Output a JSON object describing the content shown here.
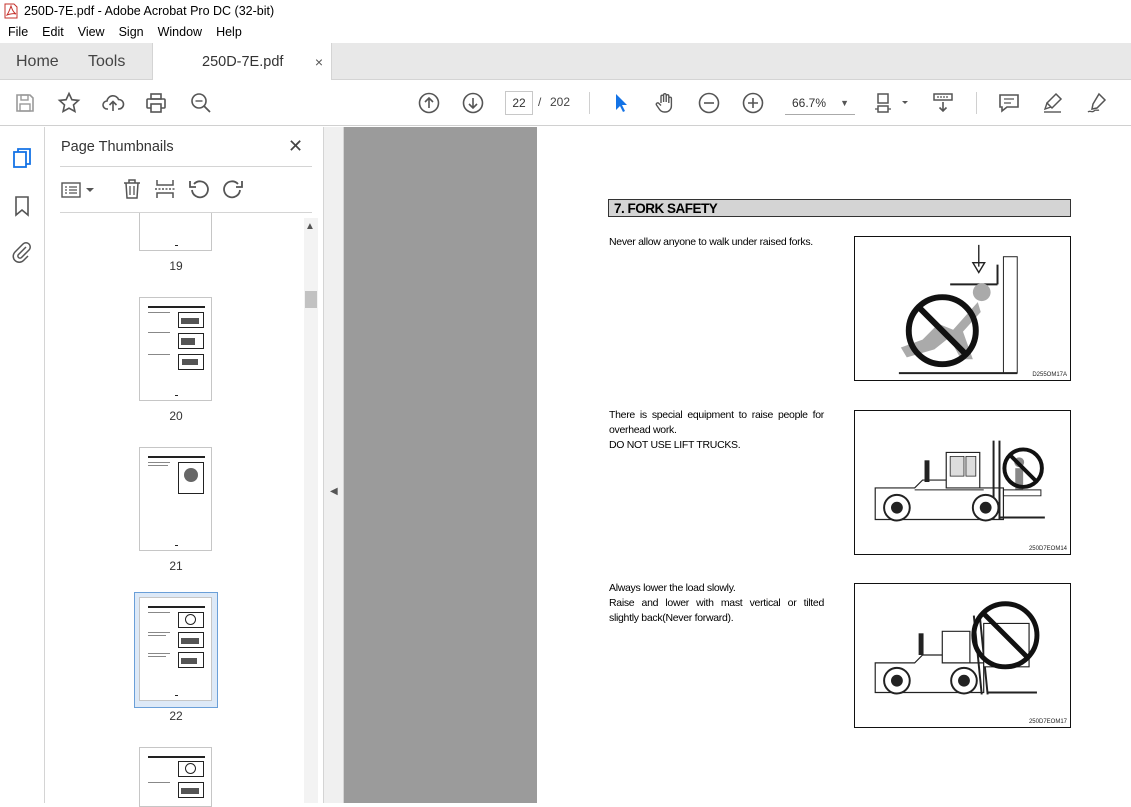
{
  "window": {
    "title": "250D-7E.pdf - Adobe Acrobat Pro DC (32-bit)"
  },
  "menu": [
    "File",
    "Edit",
    "View",
    "Sign",
    "Window",
    "Help"
  ],
  "tabs": {
    "home": "Home",
    "tools": "Tools",
    "document": "250D-7E.pdf",
    "close": "×"
  },
  "toolbar": {
    "icons": [
      "save-icon",
      "star-icon",
      "upload-icon",
      "print-icon",
      "find-icon",
      "prev-page-icon",
      "next-page-icon",
      "select-cursor-icon",
      "hand-icon",
      "zoom-out-icon",
      "zoom-in-icon",
      "fit-page-icon",
      "scroll-mode-icon",
      "comment-icon",
      "highlight-icon",
      "sign-icon"
    ],
    "page_current": "22",
    "page_sep": "/",
    "page_total": "202",
    "zoom": "66.7%",
    "accent": "#1473e6"
  },
  "thumbnails": {
    "title": "Page Thumbnails",
    "close": "✕",
    "pages": [
      "19",
      "20",
      "21",
      "22"
    ],
    "selected": "22",
    "selected_color": "#6a9fd8"
  },
  "document": {
    "section_title": "7. FORK SAFETY",
    "items": [
      {
        "lines": [
          "Never allow anyone to walk under raised forks."
        ],
        "figure_id": "D255OM17A"
      },
      {
        "lines": [
          "There is special equipment to raise people for overhead work.",
          "DO NOT USE LIFT TRUCKS."
        ],
        "figure_id": "250D7EOM14"
      },
      {
        "lines": [
          "Always lower the load slowly.",
          "Raise and lower with mast vertical or tilted slightly back(Never forward)."
        ],
        "figure_id": "250D7EOM17"
      }
    ]
  }
}
